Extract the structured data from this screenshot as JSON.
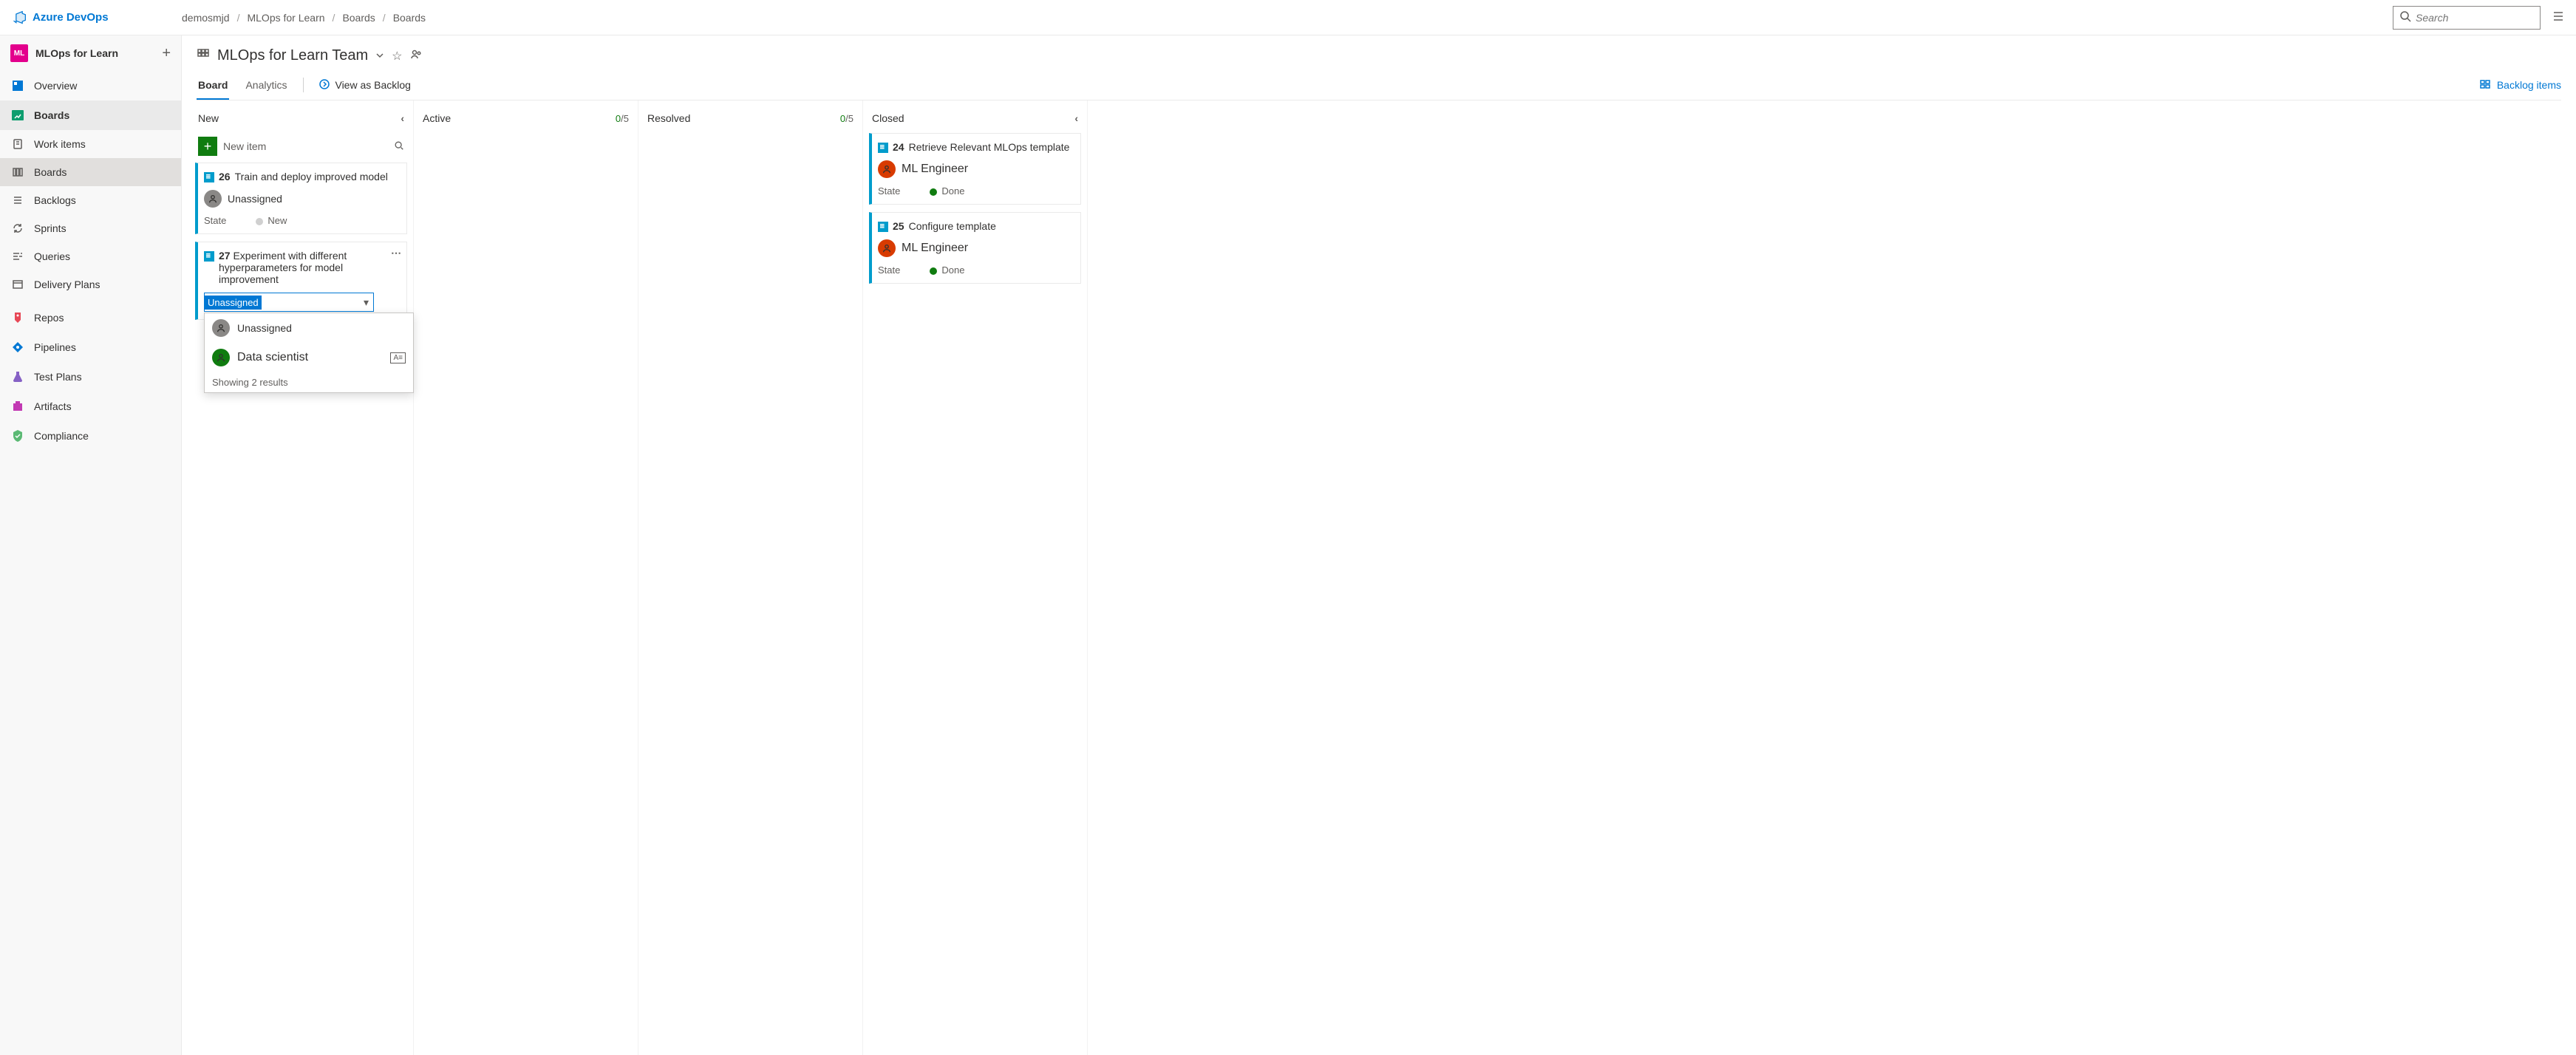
{
  "header": {
    "product": "Azure DevOps",
    "breadcrumb": [
      "demosmjd",
      "MLOps for Learn",
      "Boards",
      "Boards"
    ],
    "search_placeholder": "Search"
  },
  "sidebar": {
    "project_badge": "ML",
    "project_name": "MLOps for Learn",
    "items": [
      {
        "label": "Overview",
        "icon": "overview"
      },
      {
        "label": "Boards",
        "icon": "boards",
        "active": true,
        "children": [
          {
            "label": "Work items"
          },
          {
            "label": "Boards",
            "current": true
          },
          {
            "label": "Backlogs"
          },
          {
            "label": "Sprints"
          },
          {
            "label": "Queries"
          },
          {
            "label": "Delivery Plans"
          }
        ]
      },
      {
        "label": "Repos",
        "icon": "repos"
      },
      {
        "label": "Pipelines",
        "icon": "pipelines"
      },
      {
        "label": "Test Plans",
        "icon": "testplans"
      },
      {
        "label": "Artifacts",
        "icon": "artifacts"
      },
      {
        "label": "Compliance",
        "icon": "compliance"
      }
    ]
  },
  "board": {
    "team_title": "MLOps for Learn Team",
    "tabs": {
      "board": "Board",
      "analytics": "Analytics"
    },
    "view_backlog": "View as Backlog",
    "backlog_items": "Backlog items",
    "new_item_label": "New item",
    "columns": [
      {
        "name": "New",
        "collapse": true
      },
      {
        "name": "Active",
        "count_current": "0",
        "count_limit": "/5"
      },
      {
        "name": "Resolved",
        "count_current": "0",
        "count_limit": "/5"
      },
      {
        "name": "Closed",
        "collapse": true
      }
    ],
    "cards": {
      "new": [
        {
          "id": "26",
          "title": "Train and deploy improved model",
          "assignee": "Unassigned",
          "state_label": "State",
          "state_value": "New"
        },
        {
          "id": "27",
          "title": "Experiment with different hyperparameters for model improvement",
          "assignee_editing": true
        }
      ],
      "closed": [
        {
          "id": "24",
          "title": "Retrieve Relevant MLOps template",
          "assignee": "ML Engineer",
          "state_label": "State",
          "state_value": "Done"
        },
        {
          "id": "25",
          "title": "Configure template",
          "assignee": "ML Engineer",
          "state_label": "State",
          "state_value": "Done"
        }
      ]
    },
    "dropdown": {
      "input_value": "Unassigned",
      "options": [
        {
          "label": "Unassigned",
          "avatar": "unassigned"
        },
        {
          "label": "Data scientist",
          "avatar": "green",
          "card_icon": true
        }
      ],
      "footer": "Showing 2 results"
    }
  }
}
